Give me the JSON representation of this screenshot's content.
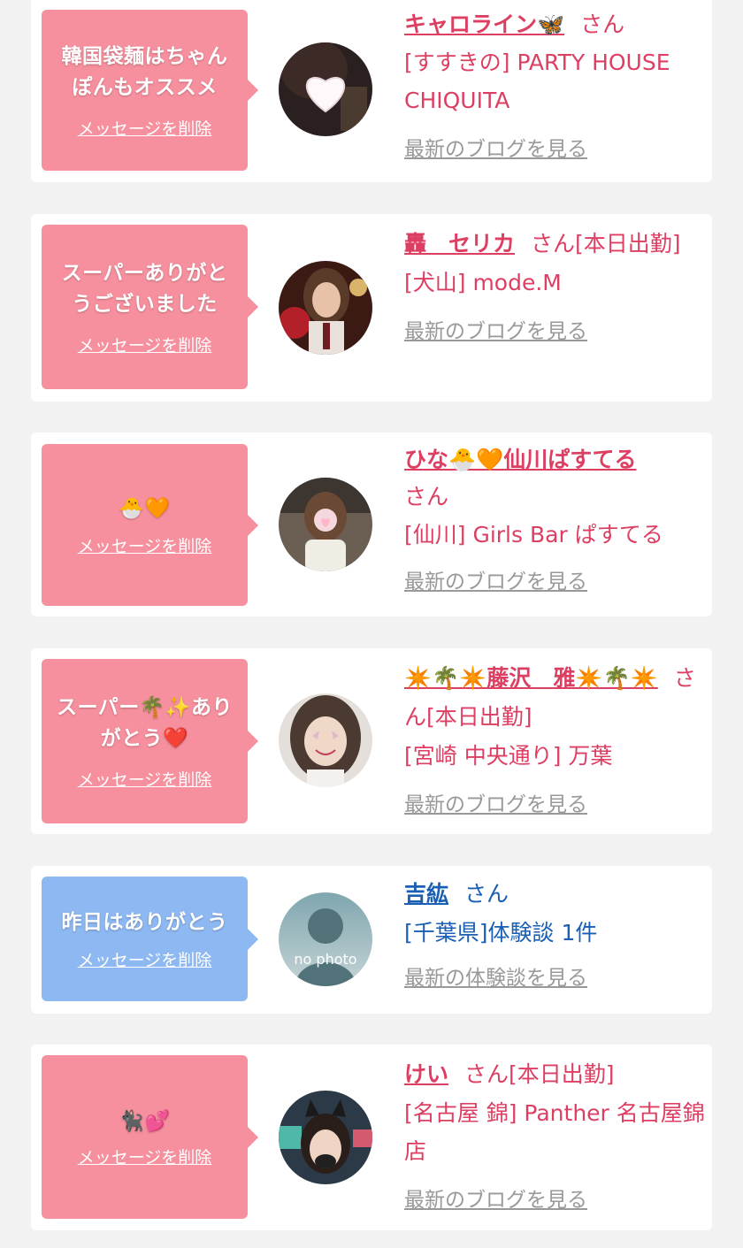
{
  "colors": {
    "page_bg": "#f2f2f2",
    "card_bg": "#ffffff",
    "pink_bubble": "#f7909e",
    "blue_bubble": "#8db8f2",
    "pink_text": "#dd3f63",
    "blue_text": "#1a5fb4",
    "gray_link": "#999999"
  },
  "delete_label": "メッセージを削除",
  "cards": [
    {
      "message": "韓国袋麺はちゃんぽんもオススメ",
      "name": "キャロライン🦋",
      "san": "さん",
      "shop": "[すすきの] PARTY HOUSE CHIQUITA",
      "link": "最新のブログを見る"
    },
    {
      "message": "スーパーありがとうございました",
      "name": "轟　セリカ",
      "san": "さん[本日出勤]",
      "shop": "[犬山] mode.M",
      "link": "最新のブログを見る"
    },
    {
      "message": "🐣🧡",
      "name": "ひな🐣🧡仙川ぱすてる",
      "san": "さん",
      "shop": "[仙川] Girls Bar ぱすてる",
      "link": "最新のブログを見る"
    },
    {
      "message": "スーパー🌴✨ありがとう❤️",
      "name": "✴️🌴✴️藤沢　雅✴️🌴✴️",
      "san": "さん[本日出勤]",
      "shop": "[宮崎 中央通り] 万葉",
      "link": "最新のブログを見る"
    },
    {
      "message": "昨日はありがとう",
      "name": "吉紘",
      "san": "さん",
      "shop": "[千葉県]体験談 1件",
      "link": "最新の体験談を見る",
      "avatar_text": "no photo"
    },
    {
      "message": "🐈‍⬛💕",
      "name": "けい",
      "san": "さん[本日出勤]",
      "shop": "[名古屋 錦] Panther 名古屋錦店",
      "link": "最新のブログを見る"
    }
  ]
}
